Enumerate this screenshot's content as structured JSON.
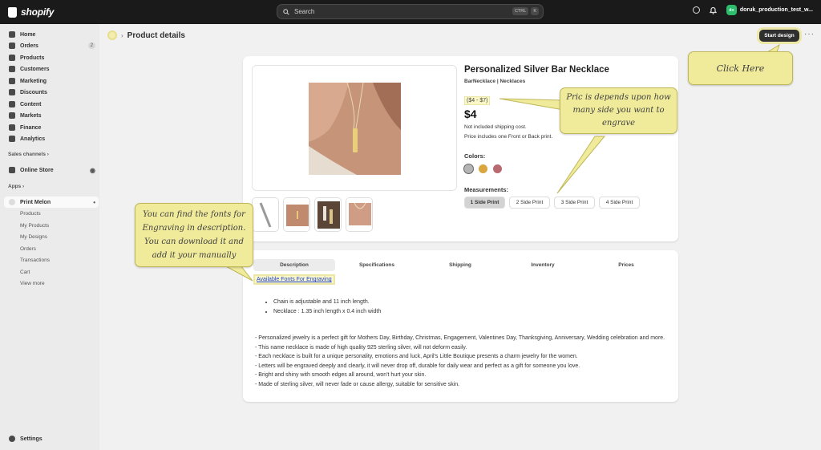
{
  "topbar": {
    "logo_text": "shopify",
    "search_placeholder": "Search",
    "kbd_ctrl": "CTRL",
    "kbd_k": "K",
    "avatar_initials": "do",
    "store_name": "doruk_production_test_w..."
  },
  "sidebar": {
    "items": [
      {
        "label": "Home",
        "icon": "home-icon"
      },
      {
        "label": "Orders",
        "icon": "orders-icon",
        "badge": "2"
      },
      {
        "label": "Products",
        "icon": "tag-icon"
      },
      {
        "label": "Customers",
        "icon": "person-icon"
      },
      {
        "label": "Marketing",
        "icon": "target-icon"
      },
      {
        "label": "Discounts",
        "icon": "discount-icon"
      },
      {
        "label": "Content",
        "icon": "content-icon"
      },
      {
        "label": "Markets",
        "icon": "globe-icon"
      },
      {
        "label": "Finance",
        "icon": "bank-icon"
      },
      {
        "label": "Analytics",
        "icon": "chart-icon"
      }
    ],
    "sales_channels_label": "Sales channels",
    "online_store_label": "Online Store",
    "apps_label": "Apps",
    "app_name": "Print Melon",
    "app_subitems": [
      "Products",
      "My Products",
      "My Designs",
      "Orders",
      "Transactions",
      "Cart",
      "View more"
    ],
    "settings_label": "Settings"
  },
  "header": {
    "title": "Product details",
    "start_design_label": "Start design",
    "more_label": "···"
  },
  "product": {
    "title": "Personalized Silver Bar Necklace",
    "brand": "BarNecklace",
    "category": "Necklaces",
    "price_range": "($4 - $7)",
    "price": "$4",
    "shipping_note": "Not included shipping cost.",
    "print_note": "Price includes one Front or Back print.",
    "colors_label": "Colors:",
    "colors": [
      "#b4b4b4",
      "#d9a640",
      "#b86a70"
    ],
    "measurements_label": "Measurements:",
    "measurements": [
      "1 Side Print",
      "2 Side Print",
      "3 Side Print",
      "4 Side Print"
    ],
    "selected_measurement": "1 Side Print"
  },
  "details": {
    "tabs": [
      "Description",
      "Specifications",
      "Shipping",
      "Inventory",
      "Prices"
    ],
    "selected_tab": "Description",
    "fonts_link": "Available Fonts For Engraving",
    "bullets": [
      "Chain is adjustable and 11 inch length.",
      "Necklace : 1.35 inch length x 0.4 inch width"
    ],
    "description": [
      "- Personalized jewelry is a perfect gift for Mothers Day, Birthday, Christmas, Engagement, Valentines Day, Thanksgiving, Anniversary, Wedding celebration and more.",
      "- This name necklace is made of high quality 925 sterling silver, will not deform easily.",
      "- Each necklace is built for a unique personality, emotions and luck, April's Little Boutique presents a charm jewelry for the women.",
      "- Letters will be engraved deeply and clearly, it will never drop off, durable for daily wear and perfect as a gift for someone you love.",
      "- Bright and shiny with smooth edges all around, won't hurt your skin.",
      "- Made of sterling silver, will never fade or cause allergy, suitable for sensitive skin."
    ]
  },
  "callouts": {
    "click_here": "Click Here",
    "price_note": "Pric is depends upon how many side you want to engrave",
    "fonts_note": "You can find the fonts for Engraving in description. You can download it and add it your manually"
  },
  "colors": {
    "topbar": "#1a1a1a",
    "callout": "#f0eb9b",
    "app_icon": "#2ebd6b"
  }
}
